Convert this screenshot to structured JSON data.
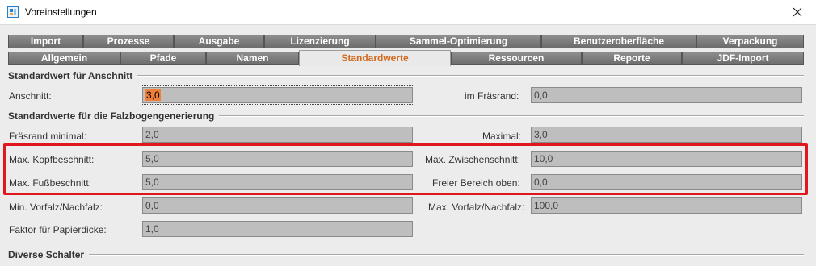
{
  "window": {
    "title": "Voreinstellungen"
  },
  "tabs_row1": [
    "Import",
    "Prozesse",
    "Ausgabe",
    "Lizenzierung",
    "Sammel-Optimierung",
    "Benutzeroberfläche",
    "Verpackung"
  ],
  "tabs_row2": [
    "Allgemein",
    "Pfade",
    "Namen",
    "Standardwerte",
    "Ressourcen",
    "Reporte",
    "JDF-Import"
  ],
  "active_tab": "Standardwerte",
  "sections": {
    "anschnitt": "Standardwert für Anschnitt",
    "falzbogen": "Standardwerte für die Falzbogengenerierung",
    "schalter": "Diverse Schalter"
  },
  "fields": {
    "anschnitt": {
      "label": "Anschnitt:",
      "value": "3,0"
    },
    "im_fraesrand": {
      "label": "im Fräsrand:",
      "value": "0,0"
    },
    "fraesrand_minimal": {
      "label": "Fräsrand minimal:",
      "value": "2,0"
    },
    "maximal": {
      "label": "Maximal:",
      "value": "3,0"
    },
    "max_kopfbeschnitt": {
      "label": "Max. Kopfbeschnitt:",
      "value": "5,0"
    },
    "max_zwischenschnitt": {
      "label": "Max. Zwischenschnitt:",
      "value": "10,0"
    },
    "max_fussbeschnitt": {
      "label": "Max. Fußbeschnitt:",
      "value": "5,0"
    },
    "freier_bereich_oben": {
      "label": "Freier Bereich oben:",
      "value": "0,0"
    },
    "min_vorfalz": {
      "label": "Min. Vorfalz/Nachfalz:",
      "value": "0,0"
    },
    "max_vorfalz": {
      "label": "Max. Vorfalz/Nachfalz:",
      "value": "100,0"
    },
    "faktor_papierdicke": {
      "label": "Faktor für Papierdicke:",
      "value": "1,0"
    }
  },
  "colors": {
    "active_tab_text": "#d2691e",
    "highlight_border": "#e0171f",
    "selection": "#f07f38"
  }
}
